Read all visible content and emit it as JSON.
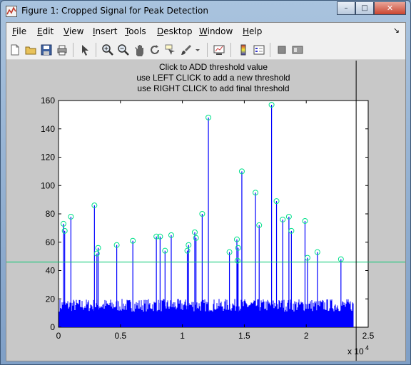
{
  "window": {
    "title": "Figure 1: Cropped Signal for Peak Detection",
    "buttons": {
      "minimize": "–",
      "maximize": "□",
      "close": "✕"
    }
  },
  "menubar": {
    "items": [
      {
        "first": "F",
        "rest": "ile"
      },
      {
        "first": "E",
        "rest": "dit"
      },
      {
        "first": "V",
        "rest": "iew"
      },
      {
        "first": "I",
        "rest": "nsert"
      },
      {
        "first": "T",
        "rest": "ools"
      },
      {
        "first": "D",
        "rest": "esktop"
      },
      {
        "first": "W",
        "rest": "indow"
      },
      {
        "first": "H",
        "rest": "elp"
      }
    ],
    "dock_icon": "↘"
  },
  "toolbar": {
    "icons": [
      "new-file-icon",
      "open-folder-icon",
      "save-icon",
      "print-icon",
      "pointer-icon",
      "zoom-in-icon",
      "zoom-out-icon",
      "pan-icon",
      "rotate-icon",
      "data-cursor-icon",
      "brush-icon",
      "dropdown-icon",
      "link-plot-icon",
      "colorbar-icon",
      "legend-icon",
      "hide-plot-tools-icon",
      "show-plot-tools-icon"
    ]
  },
  "figure": {
    "title_lines": [
      "Click to ADD threshold value",
      "use LEFT CLICK to add a new threshold",
      "use RIGHT CLICK to add final threshold"
    ]
  },
  "chart_data": {
    "type": "stem",
    "xlim": [
      0,
      25000
    ],
    "ylim": [
      0,
      160
    ],
    "x_ticks": [
      "0",
      "0.5",
      "1",
      "1.5",
      "2",
      "2.5"
    ],
    "y_ticks": [
      "0",
      "20",
      "40",
      "60",
      "80",
      "100",
      "120",
      "140",
      "160"
    ],
    "x_exponent_label": "x 10",
    "x_exponent_power": "4",
    "signal_color": "#0000ff",
    "marker_color": "#00e08a",
    "threshold_color": "#00c870",
    "cursor_line_color": "#000000",
    "noise_level": 20,
    "signal_x_end": 23800,
    "threshold": 46,
    "cursor_x": 24000,
    "peaks": [
      {
        "x": 400,
        "y": 73
      },
      {
        "x": 500,
        "y": 68
      },
      {
        "x": 1000,
        "y": 78
      },
      {
        "x": 2900,
        "y": 86
      },
      {
        "x": 3100,
        "y": 52
      },
      {
        "x": 3200,
        "y": 56
      },
      {
        "x": 4700,
        "y": 58
      },
      {
        "x": 6000,
        "y": 61
      },
      {
        "x": 7900,
        "y": 64
      },
      {
        "x": 8200,
        "y": 64
      },
      {
        "x": 8600,
        "y": 54
      },
      {
        "x": 9100,
        "y": 65
      },
      {
        "x": 10400,
        "y": 54
      },
      {
        "x": 10500,
        "y": 58
      },
      {
        "x": 11000,
        "y": 67
      },
      {
        "x": 11100,
        "y": 63
      },
      {
        "x": 11600,
        "y": 80
      },
      {
        "x": 12100,
        "y": 148
      },
      {
        "x": 13800,
        "y": 53
      },
      {
        "x": 14400,
        "y": 62
      },
      {
        "x": 14500,
        "y": 56
      },
      {
        "x": 14450,
        "y": 47
      },
      {
        "x": 14800,
        "y": 110
      },
      {
        "x": 15900,
        "y": 95
      },
      {
        "x": 16200,
        "y": 72
      },
      {
        "x": 17200,
        "y": 157
      },
      {
        "x": 17600,
        "y": 89
      },
      {
        "x": 18100,
        "y": 76
      },
      {
        "x": 18600,
        "y": 78
      },
      {
        "x": 18800,
        "y": 68
      },
      {
        "x": 19900,
        "y": 75
      },
      {
        "x": 20100,
        "y": 49
      },
      {
        "x": 20900,
        "y": 53
      },
      {
        "x": 22800,
        "y": 48
      }
    ]
  }
}
